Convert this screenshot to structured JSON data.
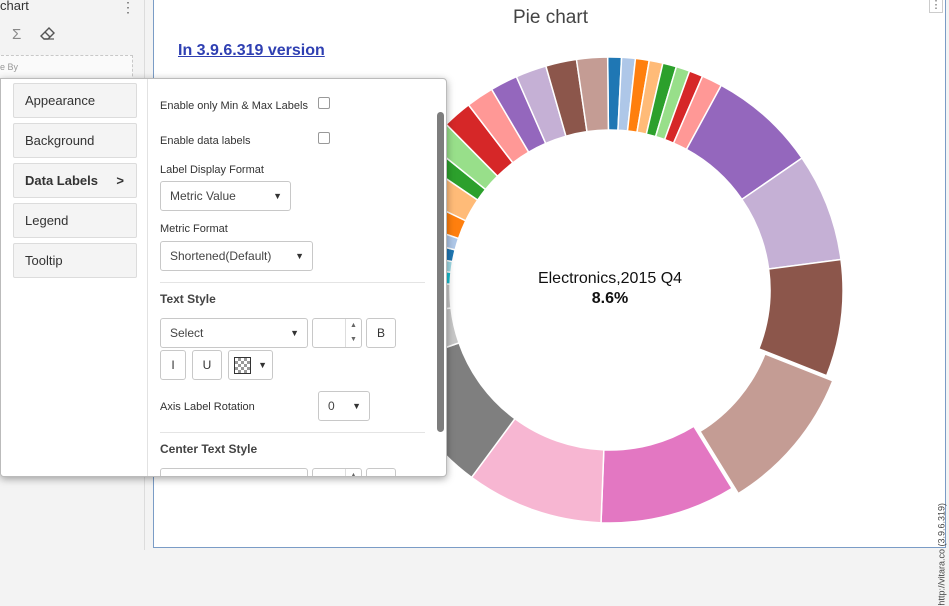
{
  "sidebar": {
    "title": "chart",
    "menu_icon": "kebab-icon",
    "sigma": "Σ",
    "drop_label": "e By"
  },
  "chart": {
    "title": "Pie chart",
    "version_text": "In 3.9.6.319 version",
    "watermark": "http://vitara.co (3.9.6.319)",
    "center_label": "Electronics,2015 Q4",
    "center_value": "8.6%"
  },
  "chart_data": {
    "type": "pie",
    "title": "Pie chart",
    "highlighted_slice": "Electronics,2015 Q4",
    "highlighted_value": "8.6%",
    "colors": [
      "#1f77b4",
      "#aec7e8",
      "#ff7f0e",
      "#ffbb78",
      "#2ca02c",
      "#98df8a",
      "#d62728",
      "#ff9896",
      "#9467bd",
      "#c5b0d5",
      "#8c564b",
      "#c49c94",
      "#e377c2",
      "#f7b6d2",
      "#7f7f7f",
      "#c7c7c7",
      "#bcbd22",
      "#dbdb8d",
      "#17becf",
      "#9edae5"
    ],
    "visible_slices": [
      {
        "color": "#1f77b4",
        "value": 0.8
      },
      {
        "color": "#aec7e8",
        "value": 0.8
      },
      {
        "color": "#ff7f0e",
        "value": 0.8
      },
      {
        "color": "#ffbb78",
        "value": 0.8
      },
      {
        "color": "#2ca02c",
        "value": 0.8
      },
      {
        "color": "#98df8a",
        "value": 0.8
      },
      {
        "color": "#d62728",
        "value": 0.8
      },
      {
        "color": "#ff9896",
        "value": 1.2
      },
      {
        "color": "#9467bd",
        "value": 6.3
      },
      {
        "color": "#c5b0d5",
        "value": 6.3
      },
      {
        "color": "#8c564b",
        "value": 6.8
      },
      {
        "color": "#c49c94",
        "value": 8.6
      },
      {
        "color": "#e377c2",
        "value": 7.9
      },
      {
        "color": "#f7b6d2",
        "value": 8.0
      },
      {
        "color": "#7f7f7f",
        "value": 8.0
      },
      {
        "color": "#c7c7c7",
        "value": 3.0
      },
      {
        "color": "#c7c7c7",
        "value": 2.0
      },
      {
        "color": "#17becf",
        "value": 1.0
      },
      {
        "color": "#9edae5",
        "value": 0.9
      },
      {
        "color": "#1f77b4",
        "value": 1.0
      },
      {
        "color": "#aec7e8",
        "value": 1.0
      },
      {
        "color": "#ff7f0e",
        "value": 1.6
      },
      {
        "color": "#ffbb78",
        "value": 2.0
      },
      {
        "color": "#2ca02c",
        "value": 1.1
      },
      {
        "color": "#98df8a",
        "value": 1.5
      },
      {
        "color": "#d62728",
        "value": 1.7
      },
      {
        "color": "#ff9896",
        "value": 1.6
      },
      {
        "color": "#9467bd",
        "value": 1.6
      },
      {
        "color": "#c5b0d5",
        "value": 1.8
      },
      {
        "color": "#8c564b",
        "value": 1.8
      },
      {
        "color": "#c49c94",
        "value": 1.8
      }
    ],
    "exploded_slice_index": 11
  },
  "popup": {
    "tabs": [
      {
        "label": "Appearance"
      },
      {
        "label": "Background"
      },
      {
        "label": "Data Labels",
        "arrow": ">"
      },
      {
        "label": "Legend"
      },
      {
        "label": "Tooltip"
      }
    ],
    "enable_min_max_label": "Enable only Min & Max Labels",
    "enable_min_max_checked": false,
    "enable_data_labels": "Enable data labels",
    "enable_data_labels_checked": false,
    "label_display_format_label": "Label Display Format",
    "label_display_format_value": "Metric Value",
    "metric_format_label": "Metric Format",
    "metric_format_value": "Shortened(Default)",
    "text_style_title": "Text Style",
    "font_select_value": "Select",
    "bold_label": "B",
    "italic_label": "I",
    "underline_label": "U",
    "axis_label_rotation_label": "Axis Label Rotation",
    "axis_label_rotation_value": "0",
    "center_text_style_title": "Center Text Style",
    "caret": "▼",
    "spin_up": "▲",
    "spin_down": "▼"
  }
}
